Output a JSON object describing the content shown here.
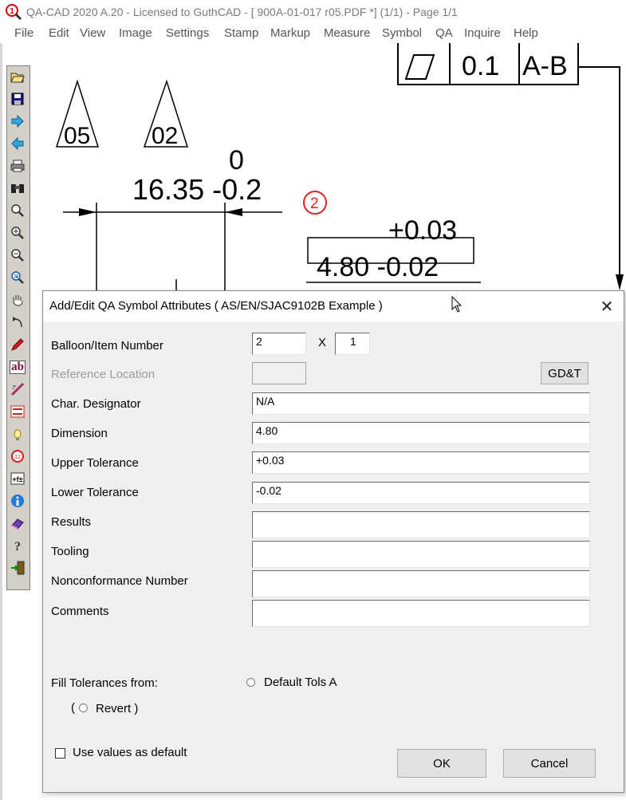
{
  "window": {
    "title": "QA-CAD 2020 A.20 - Licensed to GuthCAD  -  [ 900A-01-017 r05.PDF *] (1/1)  -  Page 1/1",
    "icon": "qa-cad-app-icon"
  },
  "menu": [
    {
      "label": "File"
    },
    {
      "label": "Edit"
    },
    {
      "label": "View"
    },
    {
      "label": "Image"
    },
    {
      "label": "Settings"
    },
    {
      "label": "Stamp"
    },
    {
      "label": "Markup"
    },
    {
      "label": "Measure"
    },
    {
      "label": "Symbol"
    },
    {
      "label": "QA"
    },
    {
      "label": "Inquire"
    },
    {
      "label": "Help"
    }
  ],
  "toolbar": {
    "icons": [
      "open-folder-icon",
      "save-icon",
      "arrow-right-icon",
      "arrow-left-icon",
      "print-icon",
      "binoculars-icon",
      "zoom-icon",
      "zoom-in-icon",
      "zoom-out-icon",
      "zoom-extents-icon",
      "pan-hand-icon",
      "undo-icon",
      "pen-icon",
      "text-ab-icon",
      "measure-icon",
      "stamp-icon",
      "bulb-icon",
      "balloon-icon",
      "tolerance-icon",
      "info-icon",
      "eraser-icon",
      "help-icon",
      "exit-icon"
    ],
    "text_ab": "ab"
  },
  "drawing": {
    "triangle_a": "05",
    "triangle_b": "02",
    "dim_upper": "0",
    "dim_main": "16.35 -0.2",
    "balloon": "2",
    "tol_upper": "+0.03",
    "tol_main": "4.80 -0.02",
    "fcf_tol": "0.1",
    "fcf_datum": "A-B"
  },
  "dialog": {
    "title": "Add/Edit QA Symbol Attributes   ( AS/EN/SJAC9102B Example )",
    "fields": {
      "balloon_label": "Balloon/Item Number",
      "balloon_value": "2",
      "x_label": "X",
      "count_value": "1",
      "reference_label": "Reference Location",
      "reference_value": "",
      "gdt_button": "GD&T",
      "char_label": "Char. Designator",
      "char_value": "N/A",
      "dimension_label": "Dimension",
      "dimension_value": "4.80",
      "upper_label": "Upper Tolerance",
      "upper_value": "+0.03",
      "lower_label": "Lower Tolerance",
      "lower_value": "-0.02",
      "results_label": "Results",
      "results_value": "",
      "tooling_label": "Tooling",
      "tooling_value": "",
      "ncr_label": "Nonconformance Number",
      "ncr_value": "",
      "comments_label": "Comments",
      "comments_value": ""
    },
    "fill_label": "Fill Tolerances from:",
    "default_tols_label": "Default Tols A",
    "revert_open": "(",
    "revert_label": "Revert )",
    "use_default_label": "Use values as default",
    "ok_label": "OK",
    "cancel_label": "Cancel"
  }
}
